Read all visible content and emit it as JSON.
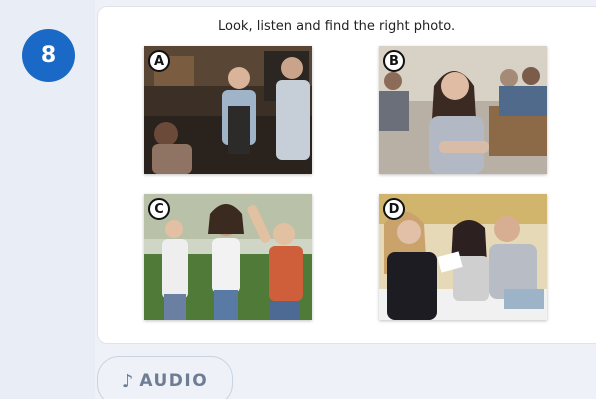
{
  "question": {
    "number": "8",
    "instruction": "Look, listen and find the right photo."
  },
  "photos": [
    {
      "label": "A",
      "description_icon": "cafe-scene-photo"
    },
    {
      "label": "B",
      "description_icon": "classroom-girl-photo"
    },
    {
      "label": "C",
      "description_icon": "friends-dancing-photo"
    },
    {
      "label": "D",
      "description_icon": "office-argument-photo"
    }
  ],
  "audio_button": {
    "icon": "music-note-icon",
    "label": "AUDIO"
  },
  "colors": {
    "accent": "#1b69c7",
    "background": "#eef2f8",
    "card": "#ffffff",
    "muted_text": "#6f7d93"
  }
}
